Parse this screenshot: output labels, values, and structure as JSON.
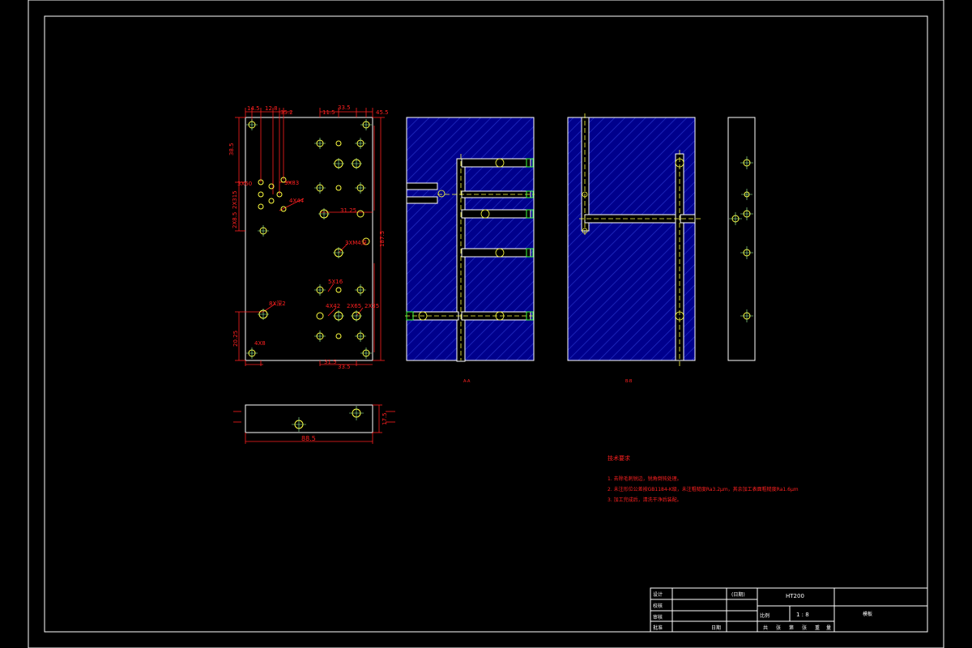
{
  "dimensions": {
    "d1": "14.5",
    "d2": "12.8",
    "d3": "35.2",
    "d4": "33.5",
    "d5": "11.5",
    "d6": "45.5",
    "d7": "38.5",
    "d8": "3X60",
    "d9": "2X315",
    "d10": "2X8.5",
    "d11": "3X83",
    "d12": "4X44",
    "d13": "31.25",
    "d14": "187.5",
    "d15": "3XM4深",
    "d16": "5X16",
    "d17": "8X深2",
    "d18": "4X42",
    "d19": "2X65",
    "d20": "2X35",
    "d21": "20.25",
    "d22": "4X8",
    "d23": "31.5",
    "d24": "33.5",
    "side_width": "88.5",
    "side_height": "17.5"
  },
  "view_labels": {
    "left": "A-A",
    "right": "B-B"
  },
  "notes": {
    "heading": "技术要求",
    "line1": "1. 去除毛刺锐边，锐角倒钝处理。",
    "line2": "2. 未注形位公差按GB1184-K级，未注粗糙度Ra3.2μm，其余加工表面粗糙度Ra1.6μm",
    "line3": "3. 加工完成后，清洗干净后装配。"
  },
  "title_block": {
    "r1c1": "设计",
    "r2c1": "校核",
    "r3c1": "审核",
    "r4c1": "批准",
    "r1c3": "(日期)",
    "r4c3": "日期",
    "material": "HT200",
    "scale_label": "比例",
    "scale_value": "1 : 8",
    "part_name": "模板",
    "bottom": [
      "共",
      "张",
      "第",
      "张",
      "重",
      "量"
    ]
  }
}
